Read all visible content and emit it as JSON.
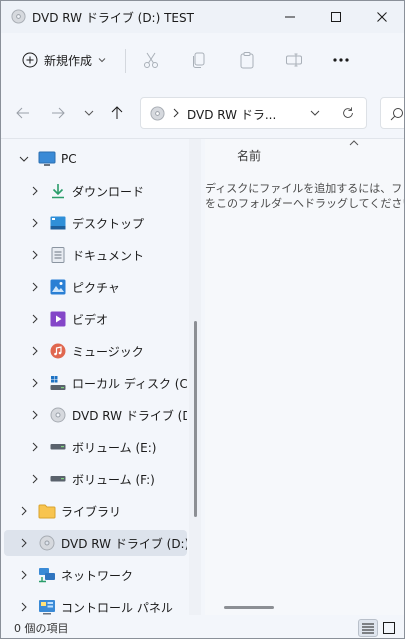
{
  "window": {
    "title": "DVD RW ドライブ (D:) TEST"
  },
  "commandbar": {
    "new_label": "新規作成"
  },
  "address": {
    "text": "DVD RW ドラ..."
  },
  "nav": {
    "items": [
      {
        "label": "PC"
      },
      {
        "label": "ダウンロード"
      },
      {
        "label": "デスクトップ"
      },
      {
        "label": "ドキュメント"
      },
      {
        "label": "ピクチャ"
      },
      {
        "label": "ビデオ"
      },
      {
        "label": "ミュージック"
      },
      {
        "label": "ローカル ディスク (C:)"
      },
      {
        "label": "DVD RW ドライブ (D:) TEST"
      },
      {
        "label": "ボリューム (E:)"
      },
      {
        "label": "ボリューム (F:)"
      },
      {
        "label": "ライブラリ"
      },
      {
        "label": "DVD RW ドライブ (D:) TEST"
      },
      {
        "label": "ネットワーク"
      },
      {
        "label": "コントロール パネル"
      }
    ]
  },
  "content": {
    "column_name": "名前",
    "empty_line1": "ディスクにファイルを追加するには、ファイル",
    "empty_line2": "をこのフォルダーへドラッグしてください。"
  },
  "status": {
    "text": "0 個の項目"
  },
  "colors": {
    "accent": "#0067c0",
    "folder": "#f8c44f",
    "selected": "#dde3ec"
  }
}
